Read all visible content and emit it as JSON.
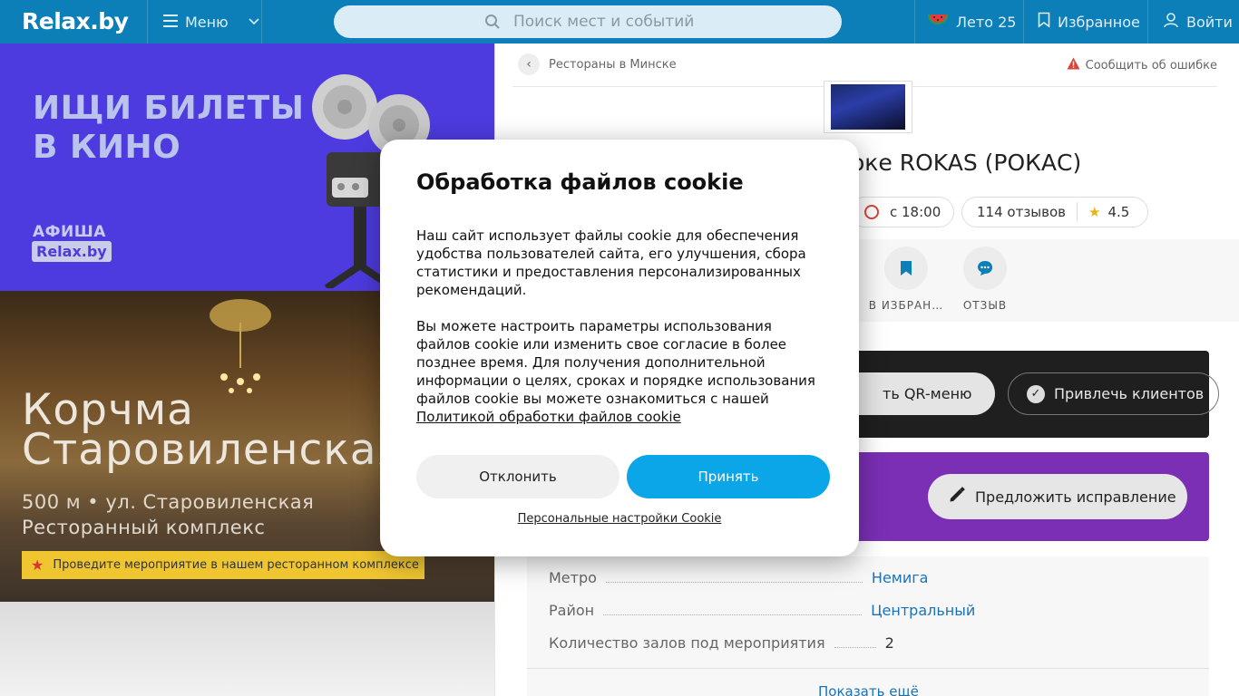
{
  "header": {
    "logo": "Relax.by",
    "menu_label": "Меню",
    "search_placeholder": "Поиск мест и событий",
    "summer_label": "Лето 25",
    "favorites_label": "Избранное",
    "login_label": "Войти"
  },
  "banners": {
    "cinema": {
      "title_line1": "ИЩИ БИЛЕТЫ",
      "title_line2": "В КИНО",
      "afisha": "АФИША",
      "brand": "Relax.by"
    },
    "korchma": {
      "title_line1": "Корчма",
      "title_line2": "Старовиленская",
      "sub_line1": "500 м • ул. Старовиленская",
      "sub_line2": "Ресторанный комплекс",
      "promo": "Проведите мероприятие в нашем ресторанном комплексе"
    }
  },
  "place": {
    "breadcrumb": "Рестораны в Минске",
    "report": "Сообщить об ошибке",
    "title_visible": "оке ROKAS (РОКАС)",
    "hours": "с 18:00",
    "reviews": "114 отзывов",
    "rating": "4.5",
    "actions": {
      "favorite": "В ИЗБРАН…",
      "review": "ОТЗЫВ"
    },
    "qr_button": "ть QR-меню",
    "attract_button": "Привлечь клиентов",
    "suggest_button": "Предложить исправление",
    "info": [
      {
        "key": "Метро",
        "value": "Немига"
      },
      {
        "key": "Район",
        "value": "Центральный"
      },
      {
        "key": "Количество залов под мероприятия",
        "value": "2"
      }
    ],
    "show_more": "Показать ещё"
  },
  "cookie_modal": {
    "title": "Обработка файлов cookie",
    "para1": "Наш сайт использует файлы cookie для обеспечения удобства пользователей сайта, его улучшения, сбора статистики и предоставления персонализированных рекомендаций.",
    "para2": "Вы можете настроить параметры использования файлов cookie или изменить свое согласие в более позднее время. Для получения дополнительной информации о целях, сроках и порядке использования файлов cookie вы можете ознакомиться с нашей",
    "policy_link": "Политикой обработки файлов cookie",
    "decline": "Отклонить",
    "accept": "Принять",
    "personal_settings": "Персональные настройки Cookie"
  },
  "colors": {
    "header_bg": "#0d7fb8",
    "accept_bg": "#0aa6e8",
    "cinema_bg": "#4d3bdf",
    "purple_panel": "#7a2fb5",
    "promo_yellow": "#f0c630",
    "link_blue": "#1a73b8"
  }
}
